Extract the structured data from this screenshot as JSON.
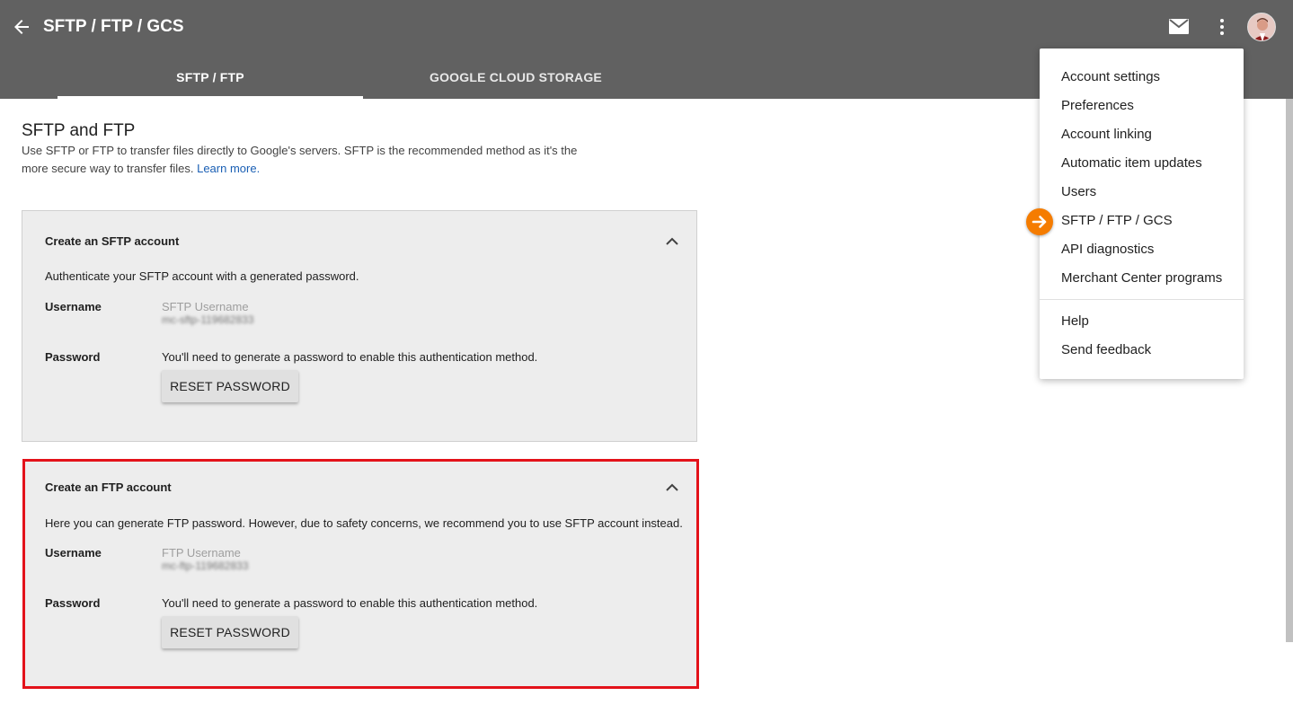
{
  "header": {
    "title": "SFTP / FTP / GCS",
    "tabs": [
      {
        "label": "SFTP / FTP",
        "active": true
      },
      {
        "label": "GOOGLE CLOUD STORAGE",
        "active": false
      }
    ]
  },
  "intro": {
    "title": "SFTP and FTP",
    "description": "Use SFTP or FTP to transfer files directly to Google's servers. SFTP is the recommended method as it's the more secure way to transfer files.",
    "learn_more": "Learn more."
  },
  "sftp_card": {
    "title": "Create an SFTP account",
    "description": "Authenticate your SFTP account with a generated password.",
    "username_label": "Username",
    "username_hint": "SFTP Username",
    "username_value": "mc-sftp-119682833",
    "password_label": "Password",
    "password_text": "You'll need to generate a password to enable this authentication method.",
    "reset_button": "RESET PASSWORD"
  },
  "ftp_card": {
    "title": "Create an FTP account",
    "description": "Here you can generate FTP password. However, due to safety concerns, we recommend you to use SFTP account instead.",
    "username_label": "Username",
    "username_hint": "FTP Username",
    "username_value": "mc-ftp-119682833",
    "password_label": "Password",
    "password_text": "You'll need to generate a password to enable this authentication method.",
    "reset_button": "RESET PASSWORD"
  },
  "menu": {
    "items": [
      {
        "label": "Account settings"
      },
      {
        "label": "Preferences"
      },
      {
        "label": "Account linking"
      },
      {
        "label": "Automatic item updates"
      },
      {
        "label": "Users"
      },
      {
        "label": "SFTP / FTP / GCS"
      },
      {
        "label": "API diagnostics"
      },
      {
        "label": "Merchant Center programs"
      },
      {
        "label": "Help"
      },
      {
        "label": "Send feedback"
      }
    ]
  },
  "colors": {
    "header_bg": "#616161",
    "card_bg": "#ededed",
    "highlight_border": "#e3121a",
    "marker": "#f57c00",
    "link": "#1a5fb4"
  },
  "icons": [
    "back-arrow-icon",
    "mail-icon",
    "more-vert-icon",
    "chevron-up-icon",
    "arrow-right-icon"
  ]
}
